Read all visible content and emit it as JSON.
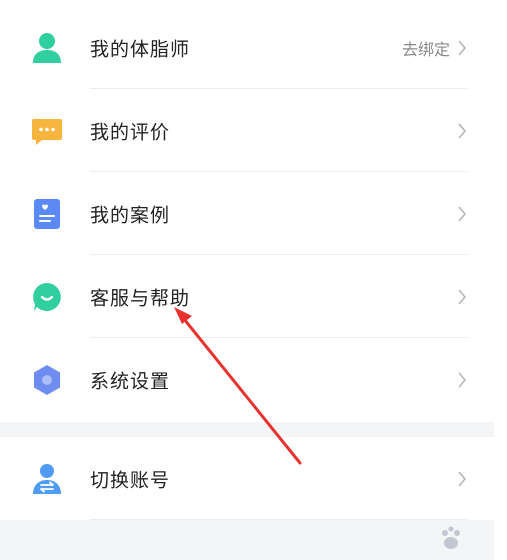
{
  "menu": {
    "items": [
      {
        "label": "我的体脂师",
        "trailing": "去绑定",
        "icon": "person-icon",
        "color": "#2fcf9f"
      },
      {
        "label": "我的评价",
        "icon": "chat-bubble-icon",
        "color": "#f5b53f"
      },
      {
        "label": "我的案例",
        "icon": "document-icon",
        "color": "#5b8af7"
      },
      {
        "label": "客服与帮助",
        "icon": "customer-service-icon",
        "color": "#2fcf9f"
      },
      {
        "label": "系统设置",
        "icon": "settings-hexagon-icon",
        "color": "#6f8cf0"
      }
    ]
  },
  "account": {
    "switch_label": "切换账号",
    "icon": "switch-account-icon",
    "color": "#4f9cf5"
  },
  "annotation": {
    "arrow_color": "#e8322e",
    "target": "客服与帮助"
  }
}
